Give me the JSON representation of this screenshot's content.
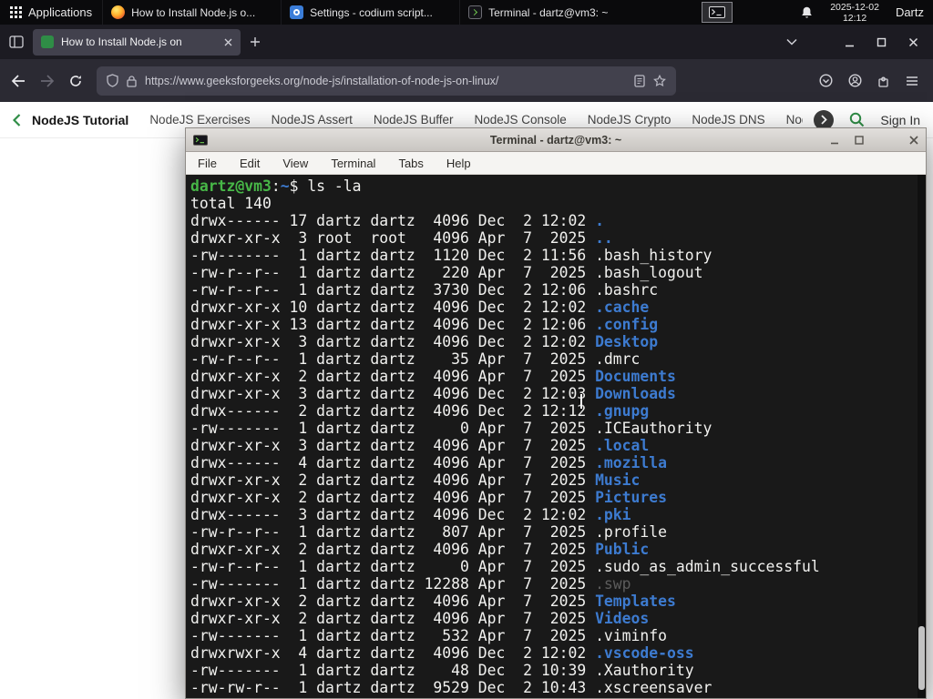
{
  "colors": {
    "gfg_green": "#2f8d46",
    "term_bg": "#191919",
    "term_fg": "#f1f1ef",
    "term_green": "#47b747",
    "term_blue": "#3d7bd0",
    "term_dim": "#5c5c5c"
  },
  "panel": {
    "applications_label": "Applications",
    "taskbar": [
      {
        "title": "How to Install Node.js o...",
        "icon": "firefox"
      },
      {
        "title": "Settings - codium script...",
        "icon": "settings"
      },
      {
        "title": "Terminal - dartz@vm3: ~",
        "icon": "terminal"
      }
    ],
    "clock_date": "2025-12-02",
    "clock_time": "12:12",
    "user": "Dartz"
  },
  "browser": {
    "tab_title": "How to Install Node.js on",
    "url": "https://www.geeksforgeeks.org/node-js/installation-of-node-js-on-linux/",
    "nav_links": [
      "NodeJS Tutorial",
      "NodeJS Exercises",
      "NodeJS Assert",
      "NodeJS Buffer",
      "NodeJS Console",
      "NodeJS Crypto",
      "NodeJS DNS",
      "Node"
    ],
    "sign_in": "Sign In"
  },
  "terminal": {
    "window_title": "Terminal - dartz@vm3: ~",
    "menu": [
      "File",
      "Edit",
      "View",
      "Terminal",
      "Tabs",
      "Help"
    ],
    "prompt": {
      "user": "dartz@vm3",
      "colon": ":",
      "path": "~",
      "dollar": "$",
      "command": "ls -la"
    },
    "total_line": "total 140",
    "listing": [
      {
        "meta": "drwx------ 17 dartz dartz  4096 Dec  2 12:02 ",
        "name": ".",
        "kind": "dir"
      },
      {
        "meta": "drwxr-xr-x  3 root  root   4096 Apr  7  2025 ",
        "name": "..",
        "kind": "dir"
      },
      {
        "meta": "-rw-------  1 dartz dartz  1120 Dec  2 11:56 ",
        "name": ".bash_history",
        "kind": "file"
      },
      {
        "meta": "-rw-r--r--  1 dartz dartz   220 Apr  7  2025 ",
        "name": ".bash_logout",
        "kind": "file"
      },
      {
        "meta": "-rw-r--r--  1 dartz dartz  3730 Dec  2 12:06 ",
        "name": ".bashrc",
        "kind": "file"
      },
      {
        "meta": "drwxr-xr-x 10 dartz dartz  4096 Dec  2 12:02 ",
        "name": ".cache",
        "kind": "dir"
      },
      {
        "meta": "drwxr-xr-x 13 dartz dartz  4096 Dec  2 12:06 ",
        "name": ".config",
        "kind": "dir"
      },
      {
        "meta": "drwxr-xr-x  3 dartz dartz  4096 Dec  2 12:02 ",
        "name": "Desktop",
        "kind": "dir"
      },
      {
        "meta": "-rw-r--r--  1 dartz dartz    35 Apr  7  2025 ",
        "name": ".dmrc",
        "kind": "file"
      },
      {
        "meta": "drwxr-xr-x  2 dartz dartz  4096 Apr  7  2025 ",
        "name": "Documents",
        "kind": "dir"
      },
      {
        "meta": "drwxr-xr-x  3 dartz dartz  4096 Dec  2 12:03 ",
        "name": "Downloads",
        "kind": "dir"
      },
      {
        "meta": "drwx------  2 dartz dartz  4096 Dec  2 12:12 ",
        "name": ".gnupg",
        "kind": "dir"
      },
      {
        "meta": "-rw-------  1 dartz dartz     0 Apr  7  2025 ",
        "name": ".ICEauthority",
        "kind": "file"
      },
      {
        "meta": "drwxr-xr-x  3 dartz dartz  4096 Apr  7  2025 ",
        "name": ".local",
        "kind": "dir"
      },
      {
        "meta": "drwx------  4 dartz dartz  4096 Apr  7  2025 ",
        "name": ".mozilla",
        "kind": "dir"
      },
      {
        "meta": "drwxr-xr-x  2 dartz dartz  4096 Apr  7  2025 ",
        "name": "Music",
        "kind": "dir"
      },
      {
        "meta": "drwxr-xr-x  2 dartz dartz  4096 Apr  7  2025 ",
        "name": "Pictures",
        "kind": "dir"
      },
      {
        "meta": "drwx------  3 dartz dartz  4096 Dec  2 12:02 ",
        "name": ".pki",
        "kind": "dir"
      },
      {
        "meta": "-rw-r--r--  1 dartz dartz   807 Apr  7  2025 ",
        "name": ".profile",
        "kind": "file"
      },
      {
        "meta": "drwxr-xr-x  2 dartz dartz  4096 Apr  7  2025 ",
        "name": "Public",
        "kind": "dir"
      },
      {
        "meta": "-rw-r--r--  1 dartz dartz     0 Apr  7  2025 ",
        "name": ".sudo_as_admin_successful",
        "kind": "file"
      },
      {
        "meta": "-rw-------  1 dartz dartz 12288 Apr  7  2025 ",
        "name": ".swp",
        "kind": "dim"
      },
      {
        "meta": "drwxr-xr-x  2 dartz dartz  4096 Apr  7  2025 ",
        "name": "Templates",
        "kind": "dir"
      },
      {
        "meta": "drwxr-xr-x  2 dartz dartz  4096 Apr  7  2025 ",
        "name": "Videos",
        "kind": "dir"
      },
      {
        "meta": "-rw-------  1 dartz dartz   532 Apr  7  2025 ",
        "name": ".viminfo",
        "kind": "file"
      },
      {
        "meta": "drwxrwxr-x  4 dartz dartz  4096 Dec  2 12:02 ",
        "name": ".vscode-oss",
        "kind": "dir"
      },
      {
        "meta": "-rw-------  1 dartz dartz    48 Dec  2 10:39 ",
        "name": ".Xauthority",
        "kind": "file"
      },
      {
        "meta": "-rw-rw-r--  1 dartz dartz  9529 Dec  2 10:43 ",
        "name": ".xscreensaver",
        "kind": "file"
      }
    ]
  }
}
